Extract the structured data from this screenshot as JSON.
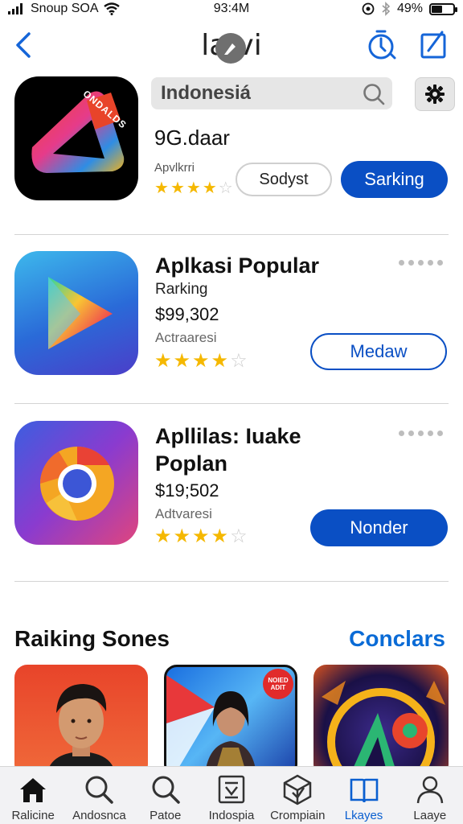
{
  "status_bar": {
    "carrier": "Snoup SOA",
    "time": "93:4M",
    "battery": "49%",
    "battery_level": 0.49
  },
  "nav": {
    "title": "la  vi"
  },
  "featured": {
    "search_value": "Indonesiá",
    "name": "9G.daar",
    "subtitle": "Apvlkrri",
    "rating": 4,
    "secondary_button": "Sodyst",
    "primary_button": "Sarking",
    "icon_text": "ONDALDS"
  },
  "apps": [
    {
      "title": "Aplkasi Popular",
      "subtitle": "Rarking",
      "price": "$99,302",
      "meta": "Actraaresi",
      "rating": 4,
      "button": "Medaw"
    },
    {
      "title_line1": "Apllilas: Iuake",
      "title_line2": "Poplan",
      "price": "$19;502",
      "meta": "Adtvaresi",
      "rating": 4,
      "button": "Nonder"
    }
  ],
  "section": {
    "title": "Raiking Sones",
    "link": "Conclars",
    "card_badge_line1": "NOIED",
    "card_badge_line2": "ADIT"
  },
  "tabs": [
    {
      "label": "Ralicine",
      "icon": "home-icon"
    },
    {
      "label": "Andosnca",
      "icon": "search-icon"
    },
    {
      "label": "Patoe",
      "icon": "search-icon"
    },
    {
      "label": "Indospia",
      "icon": "box-icon"
    },
    {
      "label": "Crompiain",
      "icon": "cube-icon"
    },
    {
      "label": "Lkayes",
      "icon": "book-icon",
      "active": true
    },
    {
      "label": "Laaye",
      "icon": "person-icon"
    }
  ],
  "colors": {
    "accent": "#0a4fc4",
    "link": "#0a6bd6",
    "star": "#f5b800"
  }
}
